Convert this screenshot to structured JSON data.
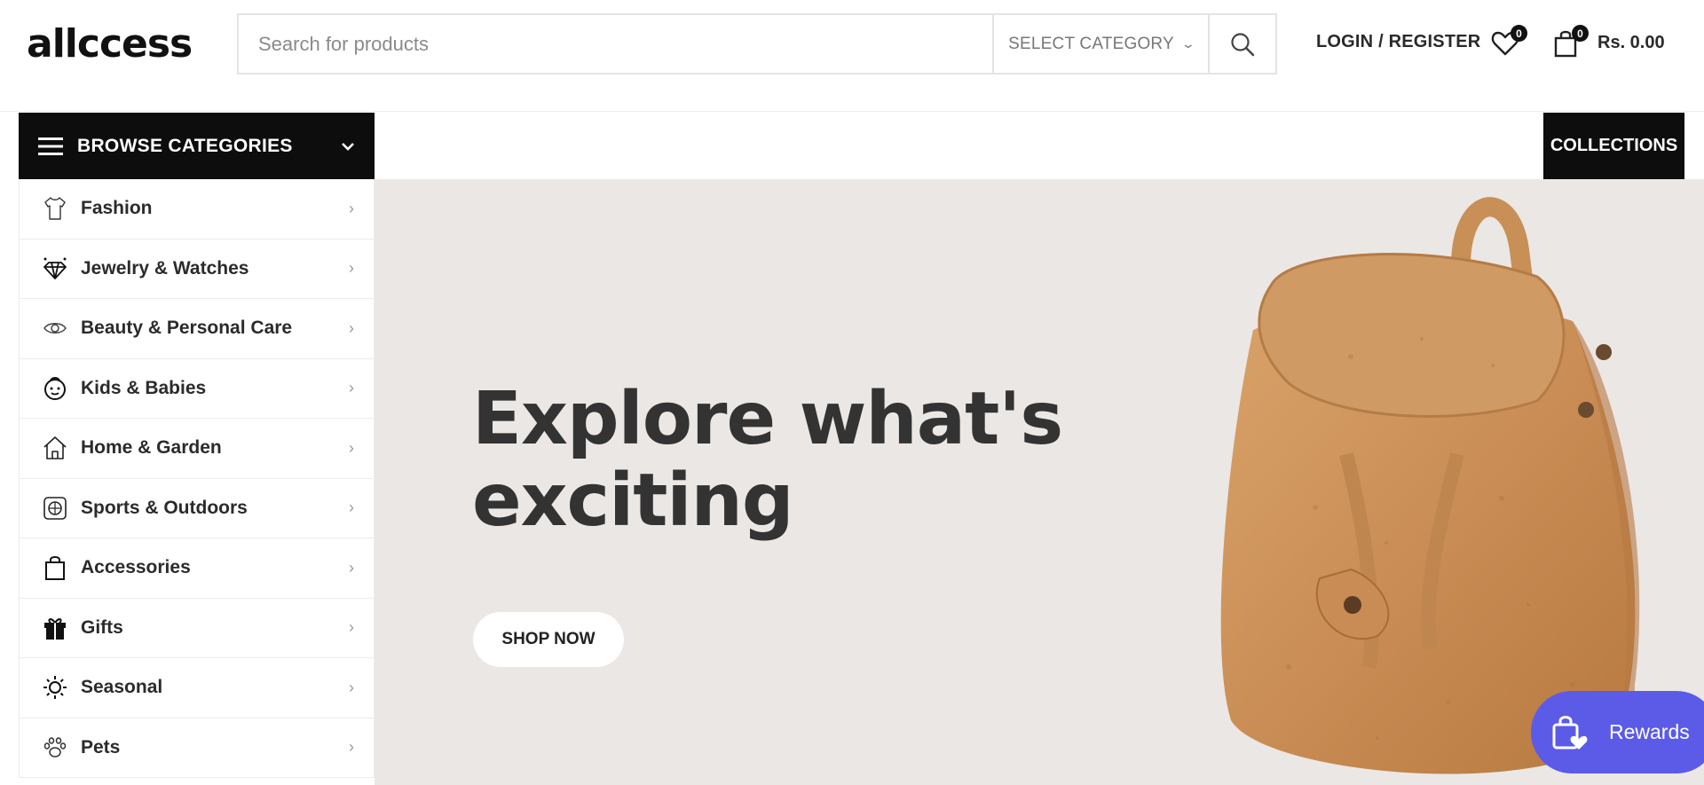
{
  "header": {
    "logo": "allccess",
    "search_placeholder": "Search for products",
    "category_label": "SELECT CATEGORY",
    "login_label": "LOGIN / REGISTER",
    "wishlist_count": "0",
    "cart_count": "0",
    "cart_total": "Rs. 0.00"
  },
  "nav": {
    "browse_label": "BROWSE CATEGORIES",
    "collections_label": "COLLECTIONS"
  },
  "sidebar": {
    "items": [
      {
        "label": "Fashion",
        "icon": "shirt-icon"
      },
      {
        "label": "Jewelry & Watches",
        "icon": "diamond-icon"
      },
      {
        "label": "Beauty & Personal Care",
        "icon": "eye-icon"
      },
      {
        "label": "Kids & Babies",
        "icon": "baby-face-icon"
      },
      {
        "label": "Home & Garden",
        "icon": "house-icon"
      },
      {
        "label": "Sports & Outdoors",
        "icon": "ball-icon"
      },
      {
        "label": "Accessories",
        "icon": "shopping-bag-icon"
      },
      {
        "label": "Gifts",
        "icon": "gift-icon"
      },
      {
        "label": "Seasonal",
        "icon": "sun-icon"
      },
      {
        "label": "Pets",
        "icon": "paw-icon"
      }
    ]
  },
  "hero": {
    "headline_line1": "Explore what's",
    "headline_line2": "exciting",
    "cta_label": "SHOP NOW"
  },
  "rewards": {
    "label": "Rewards"
  },
  "colors": {
    "dark": "#0d0d0d",
    "hero_bg": "#ebe7e4",
    "rewards_bg": "#5b5be8"
  }
}
